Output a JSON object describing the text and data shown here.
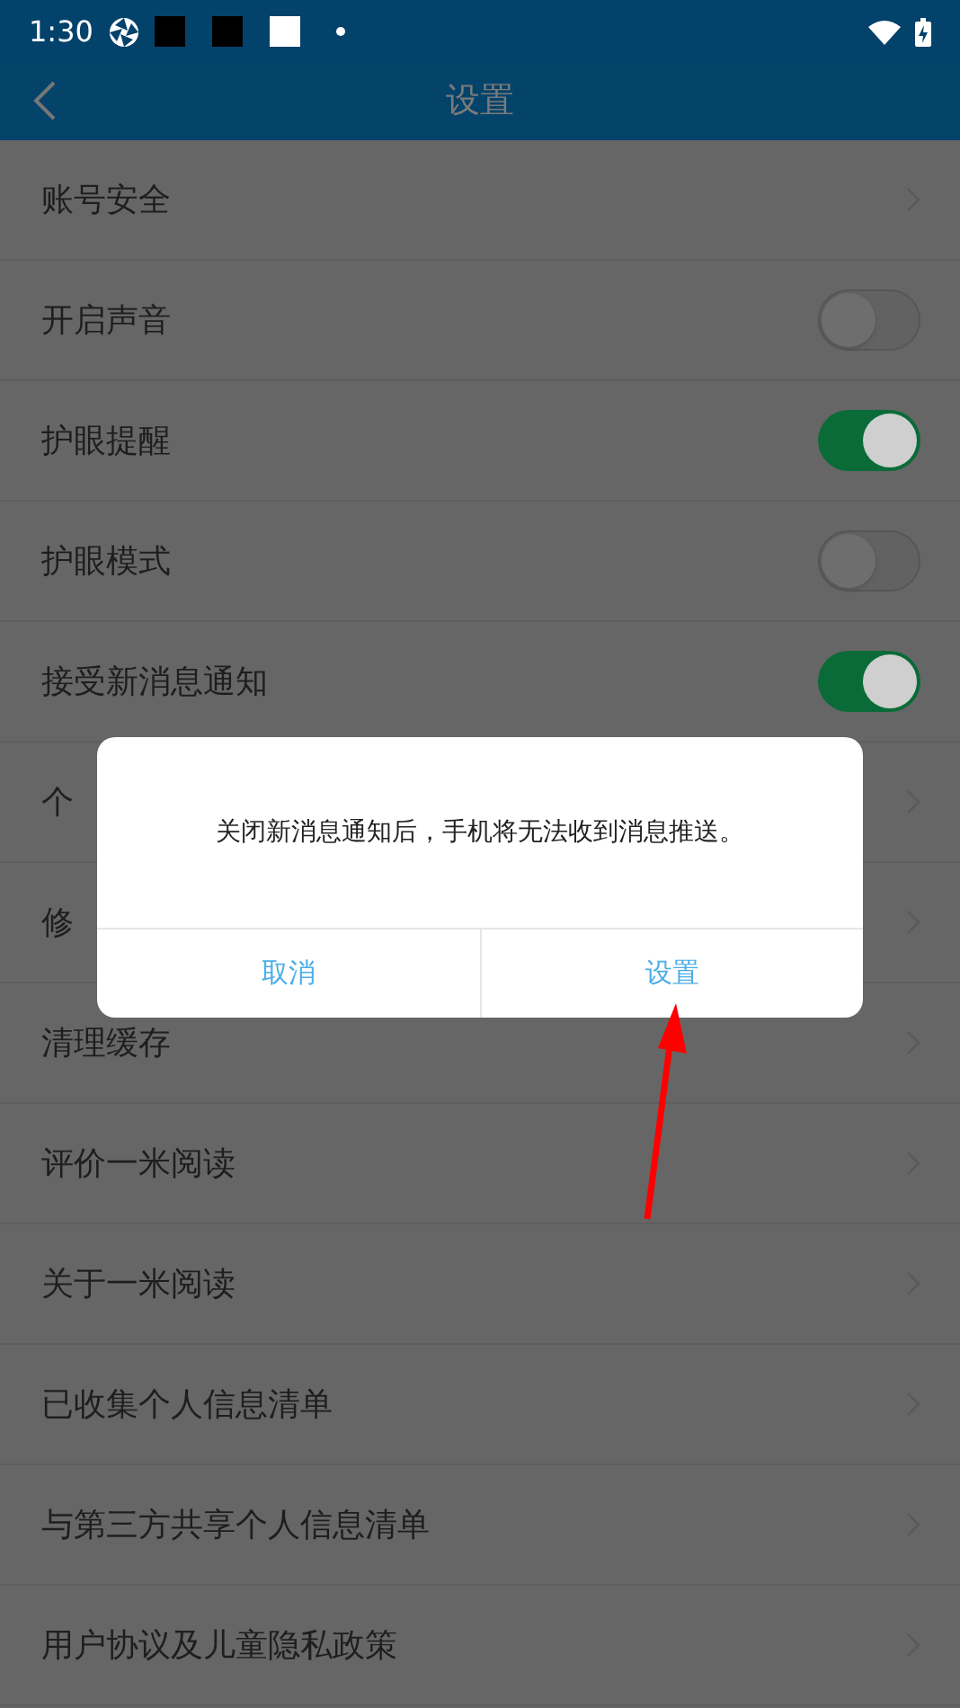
{
  "status_bar": {
    "time": "1:30"
  },
  "header": {
    "title": "设置"
  },
  "rows": [
    {
      "label": "账号安全",
      "kind": "link"
    },
    {
      "label": "开启声音",
      "kind": "toggle",
      "on": false
    },
    {
      "label": "护眼提醒",
      "kind": "toggle",
      "on": true
    },
    {
      "label": "护眼模式",
      "kind": "toggle",
      "on": false
    },
    {
      "label": "接受新消息通知",
      "kind": "toggle",
      "on": true
    },
    {
      "label": "个",
      "kind": "link"
    },
    {
      "label": "修",
      "kind": "link"
    },
    {
      "label": "清理缓存",
      "kind": "link"
    },
    {
      "label": "评价一米阅读",
      "kind": "link"
    },
    {
      "label": "关于一米阅读",
      "kind": "link"
    },
    {
      "label": "已收集个人信息清单",
      "kind": "link"
    },
    {
      "label": "与第三方共享个人信息清单",
      "kind": "link"
    },
    {
      "label": "用户协议及儿童隐私政策",
      "kind": "link"
    }
  ],
  "dialog": {
    "message": "关闭新消息通知后，手机将无法收到消息推送。",
    "buttons": [
      "取消",
      "设置"
    ]
  }
}
